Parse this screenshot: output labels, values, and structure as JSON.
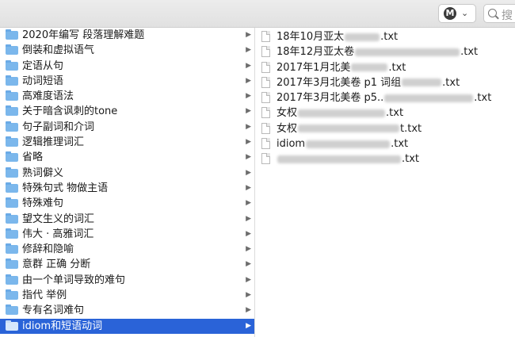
{
  "toolbar": {
    "account_initial": "M",
    "search_placeholder": "搜"
  },
  "folders": [
    {
      "label": "2020年编写 段落理解难题",
      "selected": false
    },
    {
      "label": "倒装和虚拟语气",
      "selected": false
    },
    {
      "label": "定语从句",
      "selected": false
    },
    {
      "label": "动词短语",
      "selected": false
    },
    {
      "label": "高难度语法",
      "selected": false
    },
    {
      "label": "关于暗含讽刺的tone",
      "selected": false
    },
    {
      "label": "句子副词和介词",
      "selected": false
    },
    {
      "label": "逻辑推理词汇",
      "selected": false
    },
    {
      "label": "省略",
      "selected": false
    },
    {
      "label": "熟词僻义",
      "selected": false
    },
    {
      "label": "特殊句式  物做主语",
      "selected": false
    },
    {
      "label": "特殊难句",
      "selected": false
    },
    {
      "label": "望文生义的词汇",
      "selected": false
    },
    {
      "label": "伟大 · 高雅词汇",
      "selected": false
    },
    {
      "label": "修辞和隐喻",
      "selected": false
    },
    {
      "label": "意群 正确 分断",
      "selected": false
    },
    {
      "label": "由一个单词导致的难句",
      "selected": false
    },
    {
      "label": "指代  举例",
      "selected": false
    },
    {
      "label": "专有名词难句",
      "selected": false
    },
    {
      "label": "idiom和短语动词",
      "selected": true
    }
  ],
  "files": [
    {
      "prefix": "18年10月亚太",
      "suffix": ".txt",
      "blur_width": 44
    },
    {
      "prefix": "18年12月亚太卷",
      "suffix": ".txt",
      "blur_width": 132
    },
    {
      "prefix": "2017年1月北美",
      "suffix": ".txt",
      "blur_width": 46
    },
    {
      "prefix": "2017年3月北美卷 p1 词组",
      "suffix": ".txt",
      "blur_width": 50
    },
    {
      "prefix": "2017年3月北美卷 p5..",
      "suffix": ".txt",
      "blur_width": 112
    },
    {
      "prefix": "女权",
      "suffix": ".txt",
      "blur_width": 110
    },
    {
      "prefix": "女权",
      "suffix": "t.txt",
      "blur_width": 128
    },
    {
      "prefix": "idiom",
      "suffix": ".txt",
      "blur_width": 106
    },
    {
      "prefix": "",
      "suffix": ".txt",
      "blur_width": 156
    }
  ]
}
